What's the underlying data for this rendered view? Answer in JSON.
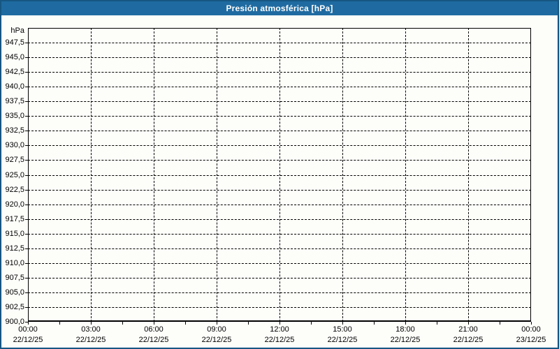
{
  "window": {
    "title": "Presión atmosférica [hPa]"
  },
  "colors": {
    "titlebar_bg": "#1f6ba1",
    "title_text": "#ffffff",
    "window_border": "#175683",
    "background": "#fdfdfa",
    "grid": "#000000"
  },
  "chart_data": {
    "type": "line",
    "title": "Presión atmosférica [hPa]",
    "y_unit_label": "hPa",
    "ylabel": "",
    "xlabel": "",
    "ylim": [
      900,
      950
    ],
    "y_tick_step": 2.5,
    "grid": "dashed",
    "legend": "none",
    "series": [],
    "y_ticks": [
      {
        "value": 947.5,
        "label": "947,5"
      },
      {
        "value": 945.0,
        "label": "945,0"
      },
      {
        "value": 942.5,
        "label": "942,5"
      },
      {
        "value": 940.0,
        "label": "940,0"
      },
      {
        "value": 937.5,
        "label": "937,5"
      },
      {
        "value": 935.0,
        "label": "935,0"
      },
      {
        "value": 932.5,
        "label": "932,5"
      },
      {
        "value": 930.0,
        "label": "930,0"
      },
      {
        "value": 927.5,
        "label": "927,5"
      },
      {
        "value": 925.0,
        "label": "925,0"
      },
      {
        "value": 922.5,
        "label": "922,5"
      },
      {
        "value": 920.0,
        "label": "920,0"
      },
      {
        "value": 917.5,
        "label": "917,5"
      },
      {
        "value": 915.0,
        "label": "915,0"
      },
      {
        "value": 912.5,
        "label": "912,5"
      },
      {
        "value": 910.0,
        "label": "910,0"
      },
      {
        "value": 907.5,
        "label": "907,5"
      },
      {
        "value": 905.0,
        "label": "905,0"
      },
      {
        "value": 902.5,
        "label": "902,5"
      },
      {
        "value": 900.0,
        "label": "900,0"
      }
    ],
    "x_major_step_hours": 3,
    "x_minor_step_hours": 1.5,
    "x_ticks": [
      {
        "time": "00:00",
        "date": "22/12/25"
      },
      {
        "time": "03:00",
        "date": "22/12/25"
      },
      {
        "time": "06:00",
        "date": "22/12/25"
      },
      {
        "time": "09:00",
        "date": "22/12/25"
      },
      {
        "time": "12:00",
        "date": "22/12/25"
      },
      {
        "time": "15:00",
        "date": "22/12/25"
      },
      {
        "time": "18:00",
        "date": "22/12/25"
      },
      {
        "time": "21:00",
        "date": "22/12/25"
      },
      {
        "time": "00:00",
        "date": "23/12/25"
      }
    ]
  }
}
